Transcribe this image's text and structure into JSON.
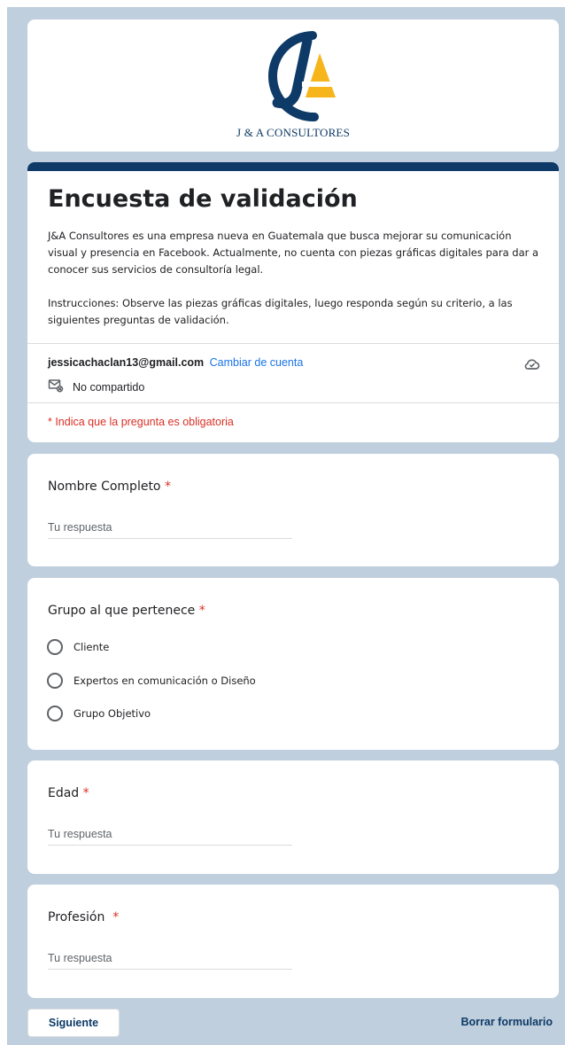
{
  "header": {
    "logo_text": "J & A CONSULTORES",
    "brand_colors": {
      "navy": "#0d3a66",
      "gold": "#f6b51a"
    }
  },
  "form": {
    "title": "Encuesta de validación",
    "description": " J&A Consultores es una empresa nueva en Guatemala que busca mejorar su comunicación visual y presencia en Facebook. Actualmente, no cuenta con piezas gráficas digitales para dar a conocer sus servicios de consultoría legal.\n\nInstrucciones: Observe las piezas gráficas digitales, luego responda según su criterio, a las siguientes preguntas de validación.",
    "account_email": "jessicachaclan13@gmail.com",
    "switch_account": "Cambiar de cuenta",
    "not_shared": "No compartido",
    "required_note": "* Indica que la pregunta es obligatoria"
  },
  "questions": [
    {
      "title": "Nombre Completo",
      "required_mark": "*",
      "placeholder": "Tu respuesta"
    },
    {
      "title": "Grupo al que pertenece",
      "required_mark": "*",
      "options": [
        "Cliente",
        "Expertos en comunicación o Diseño",
        "Grupo Objetivo"
      ]
    },
    {
      "title": "Edad",
      "required_mark": "*",
      "placeholder": "Tu respuesta"
    },
    {
      "title": "Profesión ",
      "required_mark": "*",
      "placeholder": "Tu respuesta"
    }
  ],
  "footer": {
    "next_label": "Siguiente",
    "clear_label": "Borrar formulario"
  }
}
